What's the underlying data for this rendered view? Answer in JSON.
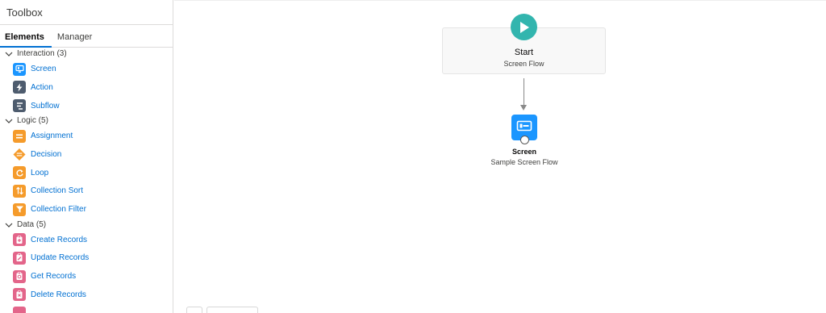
{
  "sidebar": {
    "title": "Toolbox",
    "tabs": [
      {
        "label": "Elements",
        "active": true
      },
      {
        "label": "Manager",
        "active": false
      }
    ],
    "groups": [
      {
        "label": "Interaction (3)",
        "items": [
          {
            "label": "Screen",
            "icon": "screen-icon",
            "color": "#1b96ff"
          },
          {
            "label": "Action",
            "icon": "lightning-icon",
            "color": "#4e5c6e"
          },
          {
            "label": "Subflow",
            "icon": "subflow-icon",
            "color": "#4e5c6e"
          }
        ]
      },
      {
        "label": "Logic (5)",
        "items": [
          {
            "label": "Assignment",
            "icon": "assignment-icon",
            "color": "#f59b2b"
          },
          {
            "label": "Decision",
            "icon": "decision-icon",
            "color": "#f59b2b"
          },
          {
            "label": "Loop",
            "icon": "loop-icon",
            "color": "#f59b2b"
          },
          {
            "label": "Collection Sort",
            "icon": "sort-icon",
            "color": "#f59b2b"
          },
          {
            "label": "Collection Filter",
            "icon": "filter-icon",
            "color": "#f59b2b"
          }
        ]
      },
      {
        "label": "Data (5)",
        "items": [
          {
            "label": "Create Records",
            "icon": "create-records-icon",
            "color": "#e3658a"
          },
          {
            "label": "Update Records",
            "icon": "update-records-icon",
            "color": "#e3658a"
          },
          {
            "label": "Get Records",
            "icon": "get-records-icon",
            "color": "#e3658a"
          },
          {
            "label": "Delete Records",
            "icon": "delete-records-icon",
            "color": "#e3658a"
          }
        ]
      }
    ]
  },
  "canvas": {
    "start": {
      "title": "Start",
      "subtitle": "Screen Flow",
      "color": "#32b5ae"
    },
    "screen": {
      "title": "Screen",
      "subtitle": "Sample Screen Flow",
      "color": "#1b96ff"
    }
  },
  "colors": {
    "link": "#0070d2",
    "border": "#dddbda",
    "connector": "#8a8a8a"
  }
}
